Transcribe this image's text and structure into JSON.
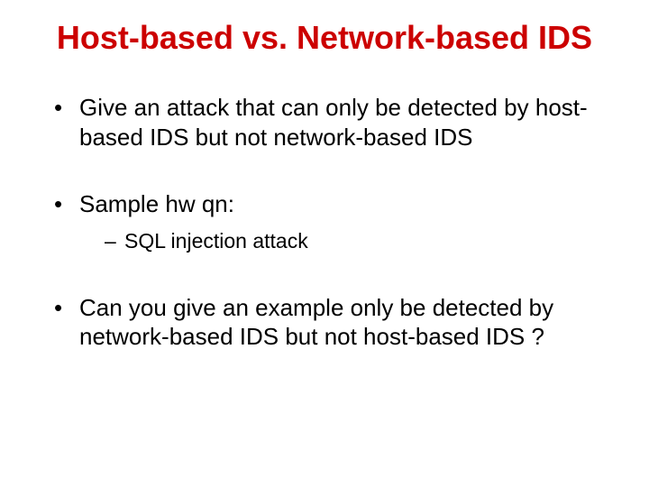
{
  "title": "Host-based vs. Network-based IDS",
  "bullets": [
    {
      "text": "Give an attack that can only be detected by host-based IDS but not network-based IDS"
    },
    {
      "text": "Sample hw qn:",
      "sub": [
        {
          "text": "SQL injection attack"
        }
      ]
    },
    {
      "text": "Can you give an example only be detected by network-based IDS but not host-based IDS ?"
    }
  ]
}
